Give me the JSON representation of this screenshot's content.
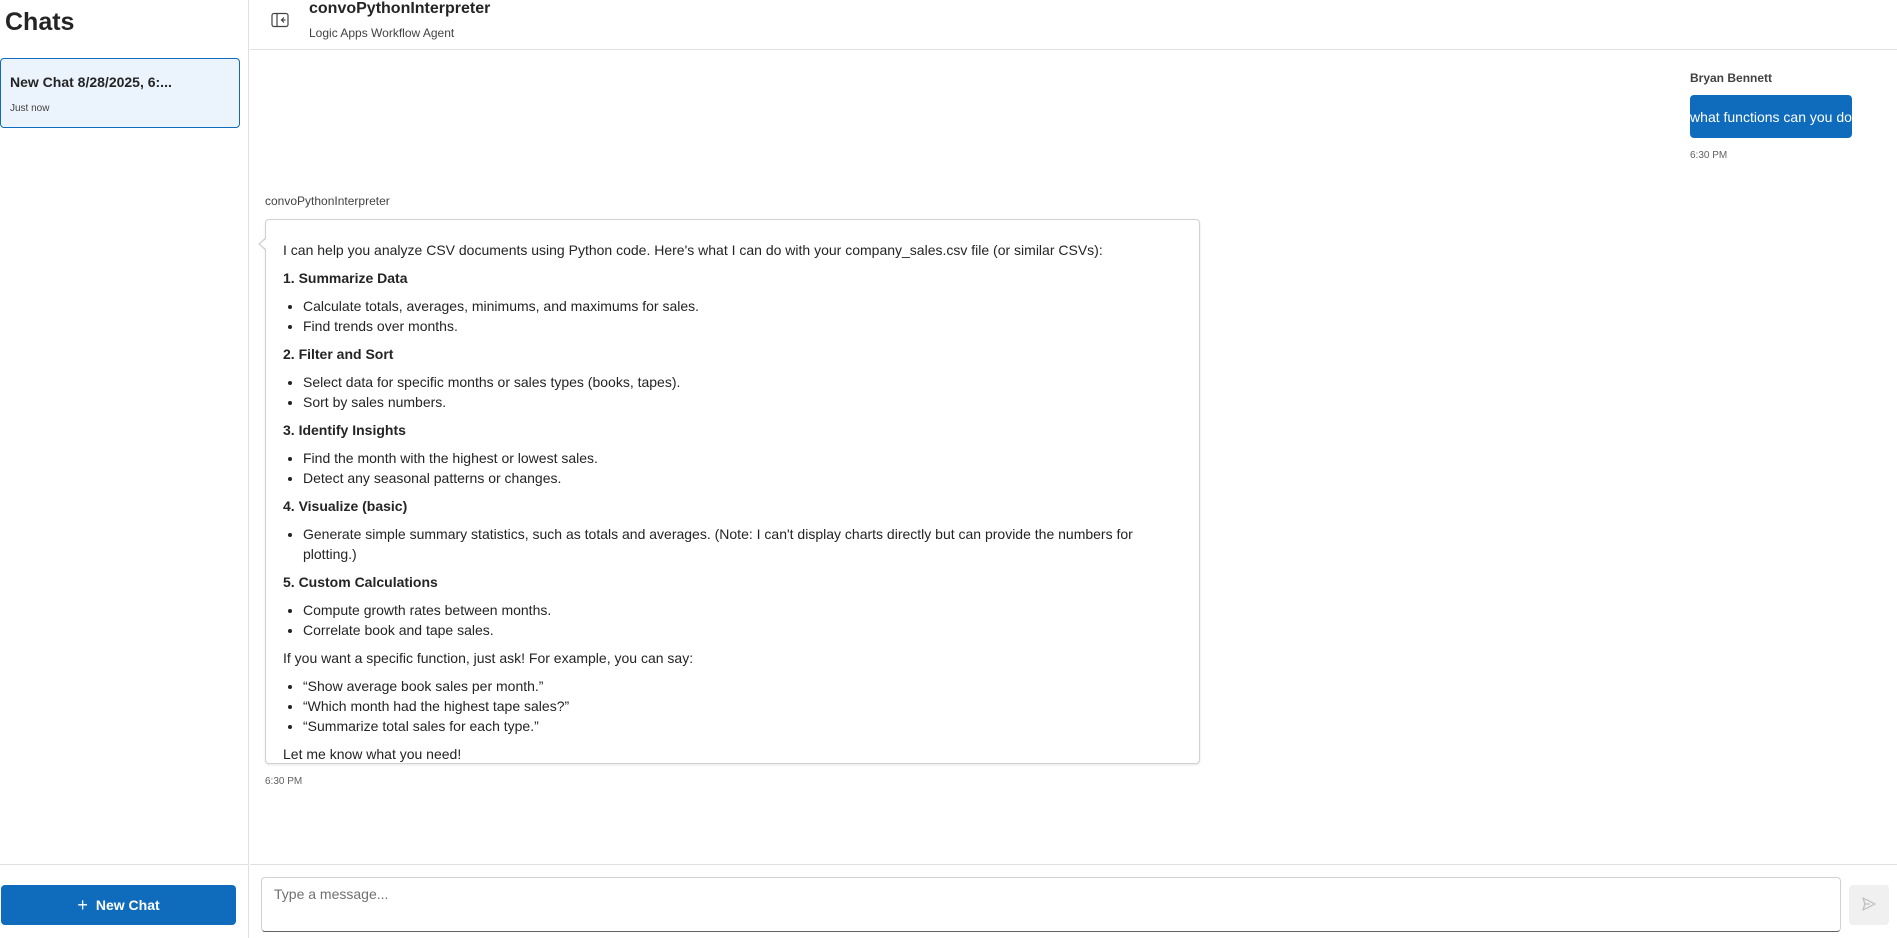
{
  "sidebar": {
    "title": "Chats",
    "chats": [
      {
        "title": "New Chat 8/28/2025, 6:...",
        "time": "Just now",
        "selected": true
      }
    ],
    "new_chat_label": "New Chat"
  },
  "header": {
    "title": "convoPythonInterpreter",
    "subtitle": "Logic Apps Workflow Agent",
    "collapse_icon": "sidebar-collapse-icon"
  },
  "conversation": {
    "user_message": {
      "author": "Bryan Bennett",
      "text": "what functions can you do",
      "time": "6:30 PM"
    },
    "bot_message": {
      "author": "convoPythonInterpreter",
      "intro": "I can help you analyze CSV documents using Python code. Here's what I can do with your company_sales.csv file (or similar CSVs):",
      "sections": [
        {
          "heading": "1. Summarize Data",
          "items": [
            "Calculate totals, averages, minimums, and maximums for sales.",
            "Find trends over months."
          ]
        },
        {
          "heading": "2. Filter and Sort",
          "items": [
            "Select data for specific months or sales types (books, tapes).",
            "Sort by sales numbers."
          ]
        },
        {
          "heading": "3. Identify Insights",
          "items": [
            "Find the month with the highest or lowest sales.",
            "Detect any seasonal patterns or changes."
          ]
        },
        {
          "heading": "4. Visualize (basic)",
          "items": [
            "Generate simple summary statistics, such as totals and averages. (Note: I can't display charts directly but can provide the numbers for plotting.)"
          ]
        },
        {
          "heading": "5. Custom Calculations",
          "items": [
            "Compute growth rates between months.",
            "Correlate book and tape sales."
          ]
        }
      ],
      "examples_intro": "If you want a specific function, just ask! For example, you can say:",
      "examples": [
        "“Show average book sales per month.”",
        "“Which month had the highest tape sales?”",
        "“Summarize total sales for each type.”"
      ],
      "closing": "Let me know what you need!",
      "time": "6:30 PM"
    }
  },
  "composer": {
    "placeholder": "Type a message...",
    "send_icon": "send-icon"
  },
  "colors": {
    "accent": "#0f6cbd",
    "selected_bg": "#ebf3fc"
  }
}
